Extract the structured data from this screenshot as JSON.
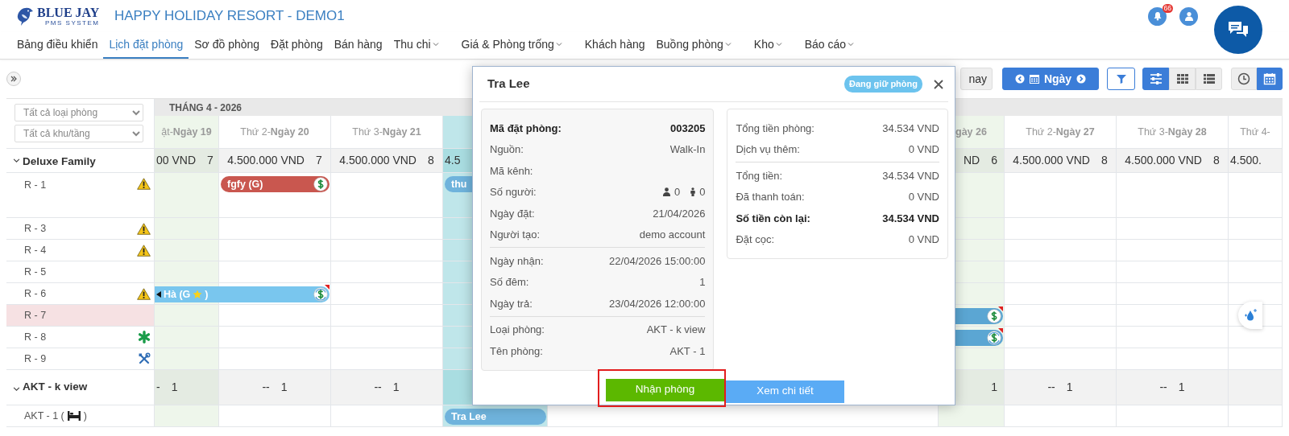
{
  "header": {
    "brand": {
      "name": "BLUE JAY",
      "tagline": "PMS SYSTEM"
    },
    "title": "HAPPY HOLIDAY RESORT - DEMO1",
    "notification_count": "66"
  },
  "nav": [
    {
      "label": "Bảng điều khiển",
      "selected": false,
      "dropdown": false
    },
    {
      "label": "Lịch đặt phòng",
      "selected": true,
      "dropdown": false
    },
    {
      "label": "Sơ đồ phòng",
      "selected": false,
      "dropdown": false
    },
    {
      "label": "Đặt phòng",
      "selected": false,
      "dropdown": false
    },
    {
      "label": "Bán hàng",
      "selected": false,
      "dropdown": false
    },
    {
      "label": "Thu chi",
      "selected": false,
      "dropdown": true
    },
    {
      "label": "Giá & Phòng trống",
      "selected": false,
      "dropdown": true
    },
    {
      "label": "Khách hàng",
      "selected": false,
      "dropdown": false
    },
    {
      "label": "Buồng phòng",
      "selected": false,
      "dropdown": true
    },
    {
      "label": "Kho",
      "selected": false,
      "dropdown": true
    },
    {
      "label": "Báo cáo",
      "selected": false,
      "dropdown": true
    }
  ],
  "toolbar": {
    "today_label": "nay",
    "date_mode": "Ngày",
    "view_buttons": [
      {
        "kind": "sliders",
        "selected": true
      },
      {
        "kind": "grid",
        "selected": false
      },
      {
        "kind": "list",
        "selected": false
      }
    ],
    "time_buttons": [
      {
        "kind": "clock",
        "selected": false
      },
      {
        "kind": "calendar",
        "selected": true
      }
    ]
  },
  "calendar": {
    "filters": [
      {
        "value": "Tất cả loại phòng"
      },
      {
        "value": "Tất cả khu/tầng"
      }
    ],
    "month": "THÁNG 4 - 2026",
    "days": [
      {
        "label": "ật-**Ngày 19**",
        "weekend": true,
        "highlighted": false
      },
      {
        "label": "Thứ 2-**Ngày 20**",
        "weekend": false,
        "highlighted": false
      },
      {
        "label": "Thứ 3-**Ngày 21**",
        "weekend": false,
        "highlighted": false
      },
      {
        "weekend": false,
        "highlighted": true
      },
      {
        "label": "**gày 26**",
        "weekend": true,
        "highlighted": false
      },
      {
        "label": "Thứ 2-**Ngày 27**",
        "weekend": false,
        "highlighted": false
      },
      {
        "label": "Thứ 3-**Ngày 28**",
        "weekend": false,
        "highlighted": false
      },
      {
        "label": "Thứ 4-",
        "weekend": false,
        "highlighted": false
      }
    ],
    "groups": [
      {
        "name": "Deluxe Family",
        "expanded": true,
        "summary_before": [
          {
            "price": "00 VND",
            "count": "7"
          },
          {
            "price": "4.500.000 VND",
            "count": "7"
          },
          {
            "price": "4.500.000 VND",
            "count": "8"
          },
          {
            "price": "4.5"
          }
        ],
        "summary_after": [
          {
            "price": "ND",
            "count": "6"
          },
          {
            "price": "4.500.000 VND",
            "count": "8"
          },
          {
            "price": "4.500.000 VND",
            "count": "8"
          },
          {
            "price": "4.500."
          }
        ],
        "rooms": [
          {
            "name": "R - 1",
            "kind": "warning",
            "highlighted": false,
            "cells": [
              {
                "occupied": false
              },
              {
                "occupied": true,
                "booking": {
                  "label": "fgfy (G)",
                  "color": "#c9574f",
                  "kind": "paid",
                  "note": false,
                  "star": false,
                  "continues_left": false
                }
              },
              {
                "occupied": false
              },
              {
                "occupied": true,
                "booking": {
                  "label": "thu",
                  "color": "#6fb3dc",
                  "kind": "plain",
                  "note": false,
                  "star": false,
                  "continues_left": false
                }
              },
              {
                "occupied": false
              },
              {
                "occupied": false
              },
              {
                "occupied": false
              },
              {
                "occupied": false
              }
            ]
          },
          {
            "name": "R - 3",
            "kind": "warning",
            "highlighted": false,
            "cells": [
              {
                "occupied": false
              },
              {
                "occupied": false
              },
              {
                "occupied": false
              },
              {
                "occupied": false
              },
              {
                "occupied": false
              },
              {
                "occupied": false
              },
              {
                "occupied": false
              },
              {
                "occupied": false
              }
            ]
          },
          {
            "name": "R - 4",
            "kind": "warning",
            "highlighted": false,
            "cells": [
              {
                "occupied": false
              },
              {
                "occupied": false
              },
              {
                "occupied": false
              },
              {
                "occupied": false
              },
              {
                "occupied": false
              },
              {
                "occupied": false
              },
              {
                "occupied": false
              },
              {
                "occupied": false
              }
            ]
          },
          {
            "name": "R - 5",
            "kind": "plain",
            "highlighted": false,
            "cells": [
              {
                "occupied": false
              },
              {
                "occupied": false
              },
              {
                "occupied": false
              },
              {
                "occupied": false
              },
              {
                "occupied": false
              },
              {
                "occupied": false
              },
              {
                "occupied": false
              },
              {
                "occupied": false
              }
            ]
          },
          {
            "name": "R - 6",
            "kind": "warning",
            "highlighted": false,
            "cells": [
              {
                "occupied": true,
                "booking": {
                  "label": "Hà (G",
                  "label_end": ")",
                  "color": "#79c6ee",
                  "kind": "partial",
                  "note": true,
                  "star": true,
                  "continues_left": true
                }
              },
              {
                "occupied": true
              },
              {
                "occupied": false
              },
              {
                "occupied": false
              },
              {
                "occupied": false
              },
              {
                "occupied": false
              },
              {
                "occupied": false
              },
              {
                "occupied": false
              }
            ]
          },
          {
            "name": "R - 7",
            "kind": "plain",
            "highlighted": true,
            "cells": [
              {
                "occupied": false
              },
              {
                "occupied": false
              },
              {
                "occupied": false
              },
              {
                "occupied": false
              },
              {
                "occupied": true,
                "booking": {
                  "color": "#5ba6d3",
                  "kind": "paid",
                  "note": true,
                  "star": false,
                  "continues_left": true
                }
              },
              {
                "occupied": false
              },
              {
                "occupied": false
              },
              {
                "occupied": false
              }
            ]
          },
          {
            "name": "R - 8",
            "kind": "cleaning",
            "highlighted": false,
            "cells": [
              {
                "occupied": false
              },
              {
                "occupied": false
              },
              {
                "occupied": false
              },
              {
                "occupied": false
              },
              {
                "occupied": true,
                "booking": {
                  "color": "#5ba6d3",
                  "kind": "partial",
                  "note": true,
                  "star": false,
                  "continues_left": true
                }
              },
              {
                "occupied": false
              },
              {
                "occupied": false
              },
              {
                "occupied": false
              }
            ]
          },
          {
            "name": "R - 9",
            "kind": "maintenance",
            "highlighted": false,
            "cells": [
              {
                "occupied": false
              },
              {
                "occupied": false
              },
              {
                "occupied": false
              },
              {
                "occupied": false
              },
              {
                "occupied": false
              },
              {
                "occupied": false
              },
              {
                "occupied": false
              },
              {
                "occupied": false
              }
            ]
          }
        ]
      },
      {
        "name": "AKT - k view",
        "expanded": true,
        "summary_before": [
          {
            "price": "-",
            "count": "1"
          },
          {
            "price": "--",
            "count": "1"
          },
          {
            "price": "--",
            "count": "1"
          }
        ],
        "summary_after": [
          {
            "count": "1"
          },
          {
            "price": "--",
            "count": "1"
          },
          {
            "price": "--",
            "count": "1"
          }
        ],
        "rooms": [
          {
            "name": "AKT - 1 (",
            "name_end": ")",
            "kind": "bed",
            "highlighted": false,
            "cells": [
              {
                "occupied": false
              },
              {
                "occupied": false
              },
              {
                "occupied": false
              },
              {
                "occupied": true,
                "booking": {
                  "label": "Tra Lee",
                  "color": "#6fb3dc",
                  "kind": "plain",
                  "note": false,
                  "star": false,
                  "continues_left": false
                }
              },
              {
                "occupied": false
              },
              {
                "occupied": false
              },
              {
                "occupied": false
              },
              {
                "occupied": false
              }
            ]
          }
        ]
      }
    ]
  },
  "modal": {
    "title": "Tra Lee",
    "status": "Đang giữ phòng",
    "left_sections": [
      [
        {
          "label": "Mã đặt phòng:",
          "value": "003205",
          "strong": true
        },
        {
          "label": "Nguồn:",
          "value": "Walk-In"
        },
        {
          "label": "Mã kênh:"
        },
        {
          "label": "Số người:",
          "kind": "guests",
          "adults": "0",
          "children": "0"
        },
        {
          "label": "Ngày đặt:",
          "value": "21/04/2026"
        },
        {
          "label": "Người tạo:",
          "value": "demo account"
        }
      ],
      [
        {
          "label": "Ngày nhận:",
          "value": "22/04/2026 15:00:00"
        },
        {
          "label": "Số đêm:",
          "value": "1"
        },
        {
          "label": "Ngày trả:",
          "value": "23/04/2026 12:00:00"
        }
      ],
      [
        {
          "label": "Loại phòng:",
          "value": "AKT - k view"
        },
        {
          "label": "Tên phòng:",
          "value": "AKT - 1"
        }
      ]
    ],
    "right_sections": [
      [
        {
          "label": "Tổng tiền phòng:",
          "value": "34.534 VND"
        },
        {
          "label": "Dịch vụ thêm:",
          "value": "0 VND"
        }
      ],
      [
        {
          "label": "Tổng tiền:",
          "value": "34.534 VND"
        },
        {
          "label": "Đã thanh toán:",
          "value": "0 VND"
        },
        {
          "label": "Số tiền còn lại:",
          "value": "34.534 VND",
          "strong": true
        },
        {
          "label": "Đặt cọc:",
          "value": "0 VND"
        }
      ]
    ],
    "buttons": [
      {
        "label": "Nhận phòng",
        "kind": "check-in",
        "highlighted": true
      },
      {
        "label": "Xem chi tiết",
        "kind": "details",
        "highlighted": false
      }
    ]
  }
}
